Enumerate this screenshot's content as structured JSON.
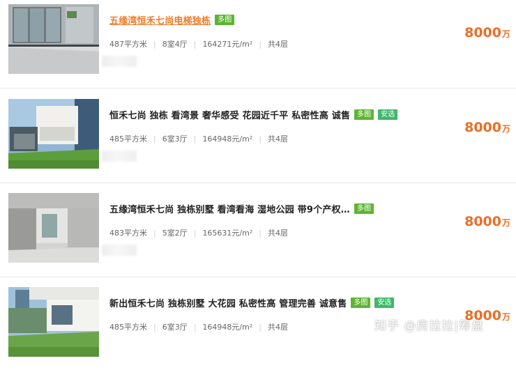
{
  "listings": [
    {
      "title": "五缘湾恒禾七尚电梯独栋",
      "tags": [
        "多图"
      ],
      "area": "487平方米",
      "layout": "8室4厅",
      "unit_price": "164271元/m²",
      "floors": "共4层",
      "price": "8000",
      "price_unit": "万"
    },
    {
      "title": "恒禾七尚 独栋 看湾景 奢华感受 花园近千平 私密性高 诚售",
      "tags": [
        "多图",
        "安选"
      ],
      "area": "485平方米",
      "layout": "6室3厅",
      "unit_price": "164948元/m²",
      "floors": "共4层",
      "price": "8000",
      "price_unit": "万"
    },
    {
      "title": "五缘湾恒禾七尚 独栋别墅 看湾看海 湿地公园 带9个产权…",
      "tags": [
        "多图"
      ],
      "area": "483平方米",
      "layout": "5室2厅",
      "unit_price": "165631元/m²",
      "floors": "共4层",
      "price": "8000",
      "price_unit": "万"
    },
    {
      "title": "新出恒禾七尚 独栋别墅 大花园 私密性高 管理完善 诚意售",
      "tags": [
        "多图",
        "安选"
      ],
      "area": "485平方米",
      "layout": "6室3厅",
      "unit_price": "164948元/m²",
      "floors": "共4层",
      "price": "8000",
      "price_unit": "万"
    }
  ],
  "watermark": "知乎 @房拉拉|筹盘",
  "colors": {
    "price": "#ec6e26",
    "title_active": "#f07a25",
    "tag_multi": "#5cb531",
    "tag_safe": "#3fb76a"
  }
}
